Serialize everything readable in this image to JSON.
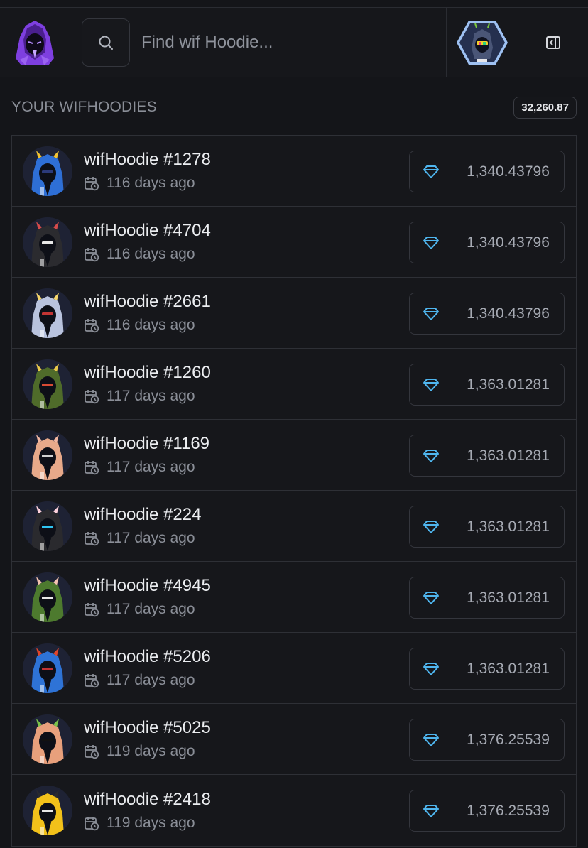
{
  "header": {
    "search_placeholder": "Find wif Hoodie...",
    "logo_icon": "hooded-figure-logo",
    "user_avatar_icon": "hoodie-avatar",
    "collapse_icon": "sidebar-collapse-icon"
  },
  "section": {
    "title": "YOUR WIFHOODIES",
    "total": "32,260.87"
  },
  "colors": {
    "accent_diamond": "#4fb6ef",
    "logo_purple": "#8a45e6"
  },
  "items": [
    {
      "name": "wifHoodie #1278",
      "date": "116 days ago",
      "value": "1,340.43796",
      "hood": "#2e6fd6",
      "ears": "#f1c232",
      "eye": "#2b3a7a"
    },
    {
      "name": "wifHoodie #4704",
      "date": "116 days ago",
      "value": "1,340.43796",
      "hood": "#2b2b2f",
      "ears": "#d44b4b",
      "eye": "#e8e8e8"
    },
    {
      "name": "wifHoodie #2661",
      "date": "116 days ago",
      "value": "1,340.43796",
      "hood": "#b9c3de",
      "ears": "#f5d56b",
      "eye": "#c23434"
    },
    {
      "name": "wifHoodie #1260",
      "date": "117 days ago",
      "value": "1,363.01281",
      "hood": "#4f6b2a",
      "ears": "#e9c84a",
      "eye": "#d84b34"
    },
    {
      "name": "wifHoodie #1169",
      "date": "117 days ago",
      "value": "1,363.01281",
      "hood": "#e7a98a",
      "ears": "#f2b6a0",
      "eye": "#d0d0d0"
    },
    {
      "name": "wifHoodie #224",
      "date": "117 days ago",
      "value": "1,363.01281",
      "hood": "#2a2a2e",
      "ears": "#ffd2dc",
      "eye": "#2fc4f2"
    },
    {
      "name": "wifHoodie #4945",
      "date": "117 days ago",
      "value": "1,363.01281",
      "hood": "#4d7a2e",
      "ears": "#f4c4b0",
      "eye": "#e8e8e8"
    },
    {
      "name": "wifHoodie #5206",
      "date": "117 days ago",
      "value": "1,363.01281",
      "hood": "#2e73d6",
      "ears": "#e0452a",
      "eye": "#c23434"
    },
    {
      "name": "wifHoodie #5025",
      "date": "119 days ago",
      "value": "1,376.25539",
      "hood": "#e8a07c",
      "ears": "#7bc24a",
      "eye": "#111111"
    },
    {
      "name": "wifHoodie #2418",
      "date": "119 days ago",
      "value": "1,376.25539",
      "hood": "#f2c11a",
      "ears": "#2a2a2e",
      "eye": "#e8e8e8"
    }
  ]
}
